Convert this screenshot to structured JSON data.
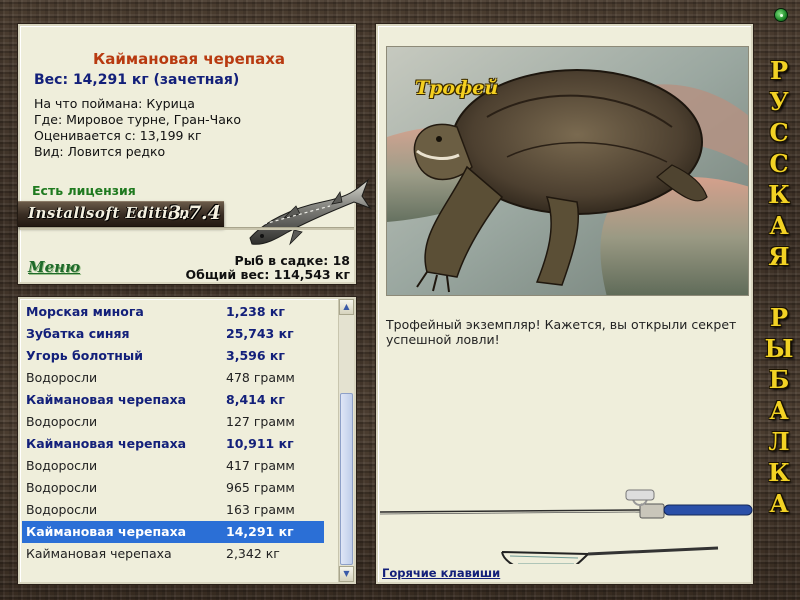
{
  "fish_info": {
    "name": "Каймановая черепаха",
    "weight": "Вес: 14,291 кг (зачетная)",
    "bait": "На что поймана: Курица",
    "location": "Где: Мировое турне, Гран-Чако",
    "valued": "Оценивается с: 13,199 кг",
    "rarity": "Вид: Ловится редко",
    "license": "Есть лицензия"
  },
  "edition": {
    "name": "Installsoft Edition",
    "version": "3.7.4"
  },
  "menu_label": "Меню",
  "keepnet": {
    "count": "Рыб в садке: 18",
    "total": "Общий вес: 114,543 кг"
  },
  "catch_list": [
    {
      "name": "Морская минога",
      "weight": "1,238 кг",
      "trophy": true
    },
    {
      "name": "Зубатка синяя",
      "weight": "25,743 кг",
      "trophy": true
    },
    {
      "name": "Угорь болотный",
      "weight": "3,596 кг",
      "trophy": true
    },
    {
      "name": "Водоросли",
      "weight": "478 грамм",
      "trophy": false
    },
    {
      "name": "Каймановая черепаха",
      "weight": "8,414 кг",
      "trophy": true
    },
    {
      "name": "Водоросли",
      "weight": "127 грамм",
      "trophy": false
    },
    {
      "name": "Каймановая черепаха",
      "weight": "10,911 кг",
      "trophy": true
    },
    {
      "name": "Водоросли",
      "weight": "417 грамм",
      "trophy": false
    },
    {
      "name": "Водоросли",
      "weight": "965 грамм",
      "trophy": false
    },
    {
      "name": "Водоросли",
      "weight": "163 грамм",
      "trophy": false
    },
    {
      "name": "Каймановая черепаха",
      "weight": "14,291 кг",
      "trophy": true,
      "selected": true
    },
    {
      "name": "Каймановая черепаха",
      "weight": "2,342 кг",
      "trophy": false
    }
  ],
  "trophy": {
    "label": "Трофей",
    "description": "Трофейный экземпляр! Кажется, вы открыли секрет успешной ловли!"
  },
  "hotkeys_label": "Горячие клавиши",
  "side_title_words": [
    "Русская",
    "рыбалка"
  ],
  "colors": {
    "panel_bg": "#efeedb",
    "trophy_text": "#13207a",
    "title_red": "#b83a10",
    "license_green": "#1f7a1f",
    "selected_row": "#2b6fd6",
    "side_title_gold": "#f2d224"
  },
  "icons": {
    "fish_art": "sturgeon-icon",
    "rod_art": "fishing-rod-icon",
    "net_art": "landing-net-icon",
    "corner": "green-orb-icon"
  }
}
